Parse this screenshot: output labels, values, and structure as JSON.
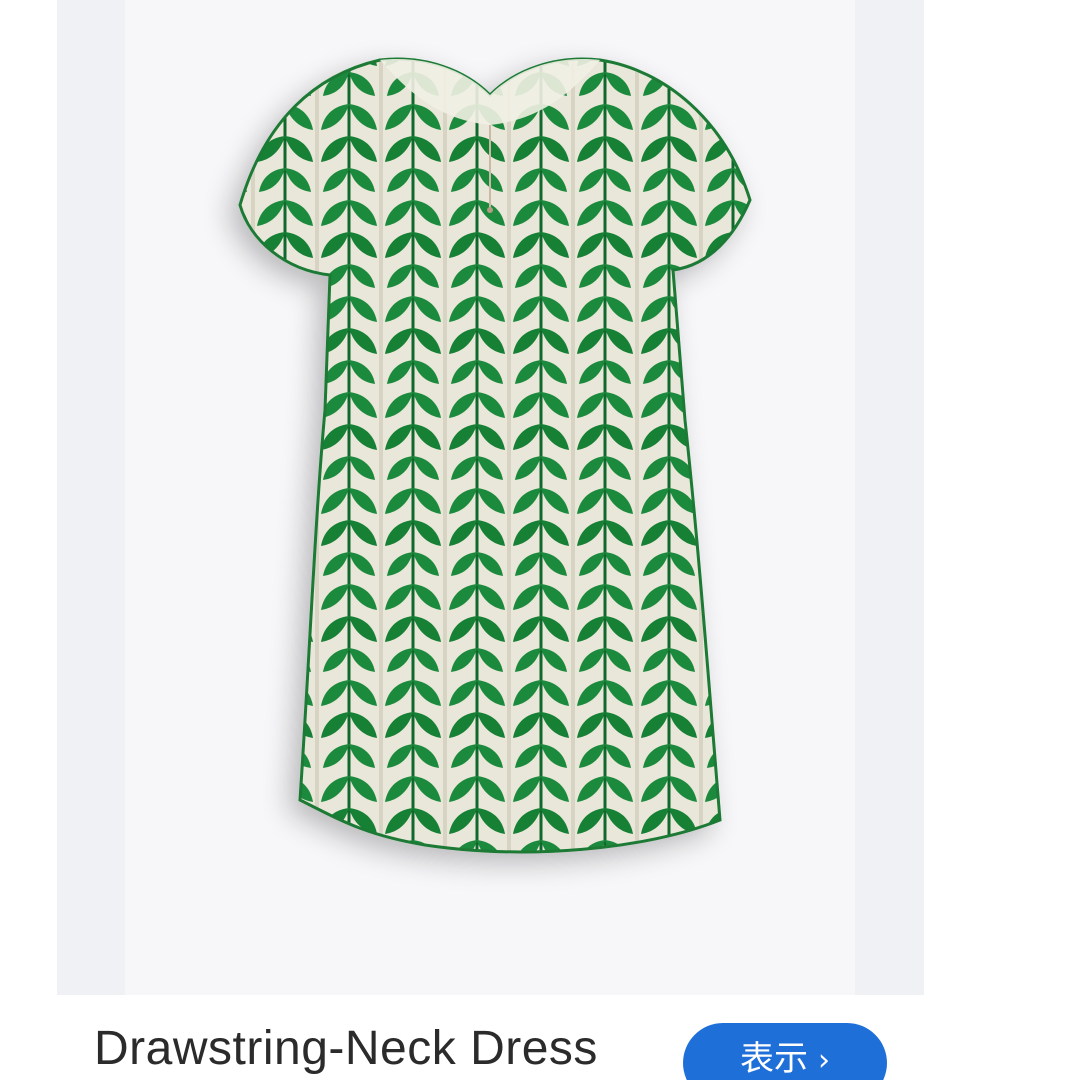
{
  "product": {
    "title": "Drawstring-Neck Dress",
    "image_icon": "dress-photo",
    "pattern_colors": {
      "primary": "#1f8a3d",
      "secondary": "#e9e7da",
      "dark": "#0f6a2c"
    }
  },
  "actions": {
    "view_label": "表示",
    "view_chevron": "›",
    "view_color": "#1f6fd8"
  }
}
